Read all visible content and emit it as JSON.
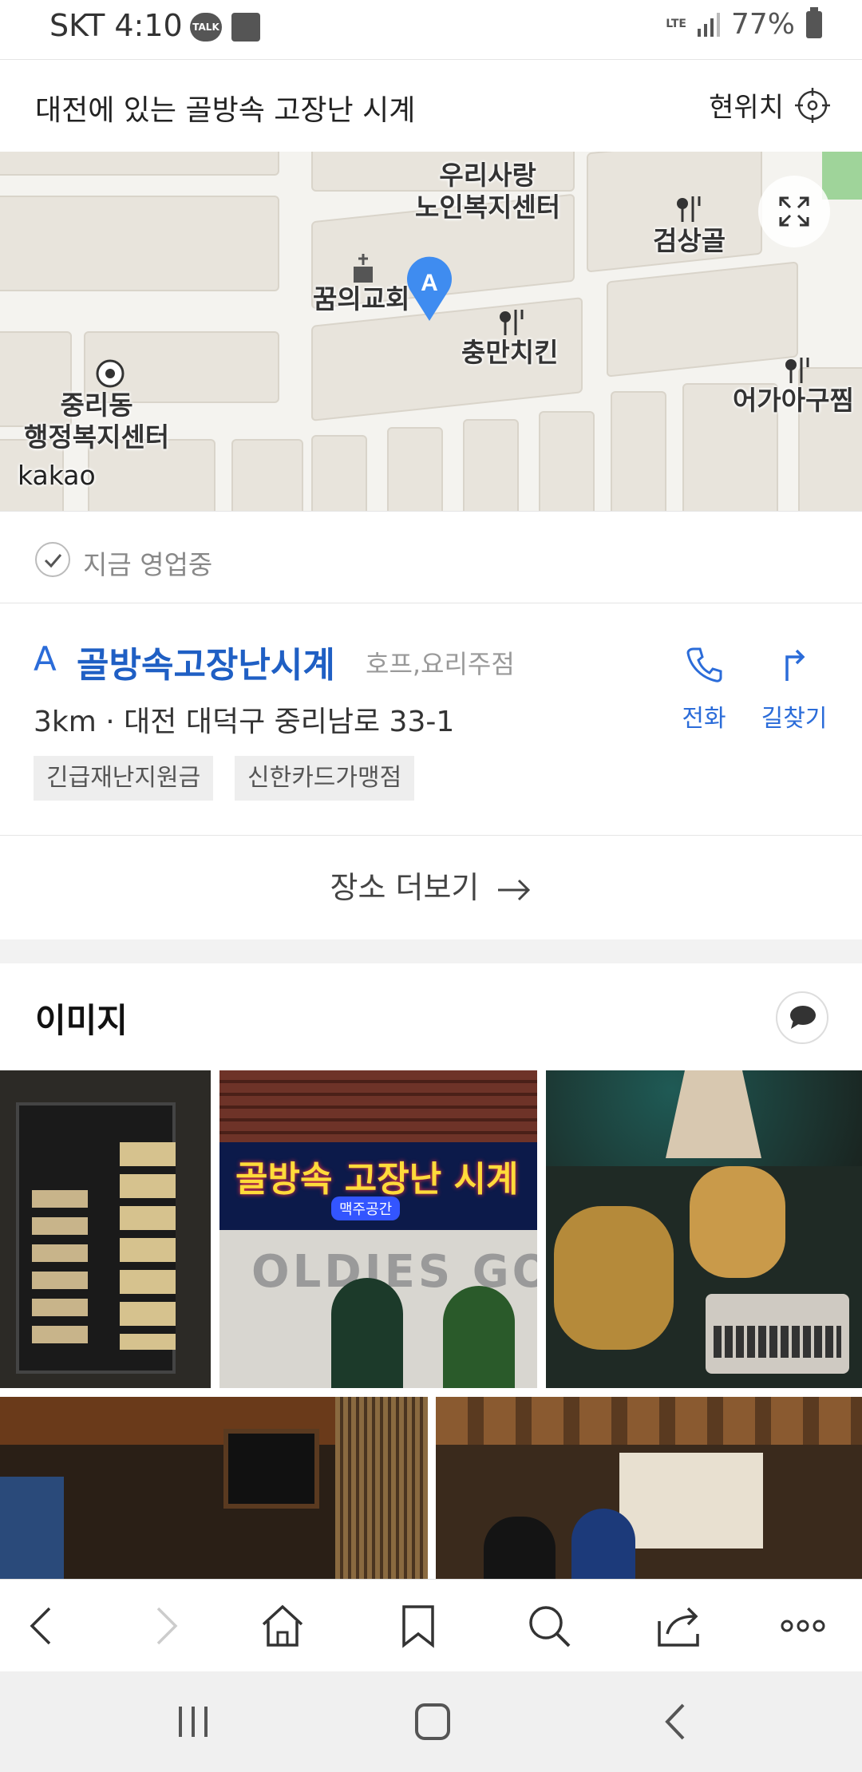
{
  "status_bar": {
    "carrier_time": "SKT 4:10",
    "talk_icon_label": "TALK",
    "network": "LTE",
    "battery": "77%"
  },
  "search": {
    "query": "대전에 있는 골방속 고장난 시계",
    "location_button": "현위치"
  },
  "map": {
    "labels": {
      "senior_center": "우리사랑\n노인복지센터",
      "geomsanggol": "검상골",
      "church": "꿈의교회",
      "chicken": "충만치킨",
      "jungri_office": "중리동\n행정복지센터",
      "eogaagu": "어가아구찜",
      "kakao": "kakao"
    },
    "marker_letter": "A"
  },
  "open_now": "지금 영업중",
  "place": {
    "marker": "A",
    "name": "골방속고장난시계",
    "category": "호프,요리주점",
    "address": "3km · 대전 대덕구 중리남로 33-1",
    "tags": [
      "긴급재난지원금",
      "신한카드가맹점"
    ],
    "call_label": "전화",
    "route_label": "길찾기"
  },
  "more_place": "장소 더보기",
  "images": {
    "title": "이미지",
    "sign_text_line1": "골방속 고장난 시계",
    "sign_text_line2": "맥주공간",
    "wall_text": "OLDIES GOODIES"
  },
  "colors": {
    "accent": "#2b6cd9",
    "place_name": "#1f5fc4",
    "marker": "#3f8cf0"
  }
}
